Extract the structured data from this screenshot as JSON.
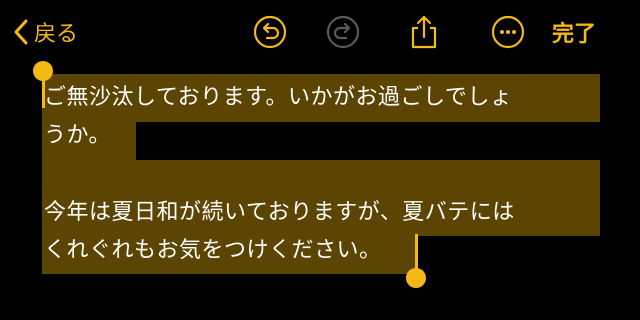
{
  "toolbar": {
    "back_label": "戻る",
    "done_label": "完了",
    "accent_color": "#f5b915",
    "icons": [
      "chevron-left-icon",
      "undo-icon",
      "redo-icon",
      "share-icon",
      "more-icon"
    ]
  },
  "note": {
    "lines": [
      "ご無沙汰しております。いかがお過ごしでしょ",
      "うか。",
      "",
      "今年は夏日和が続いておりますが、夏バテには",
      "くれぐれもお気をつけください。"
    ],
    "selection_color": "#5c4503"
  }
}
